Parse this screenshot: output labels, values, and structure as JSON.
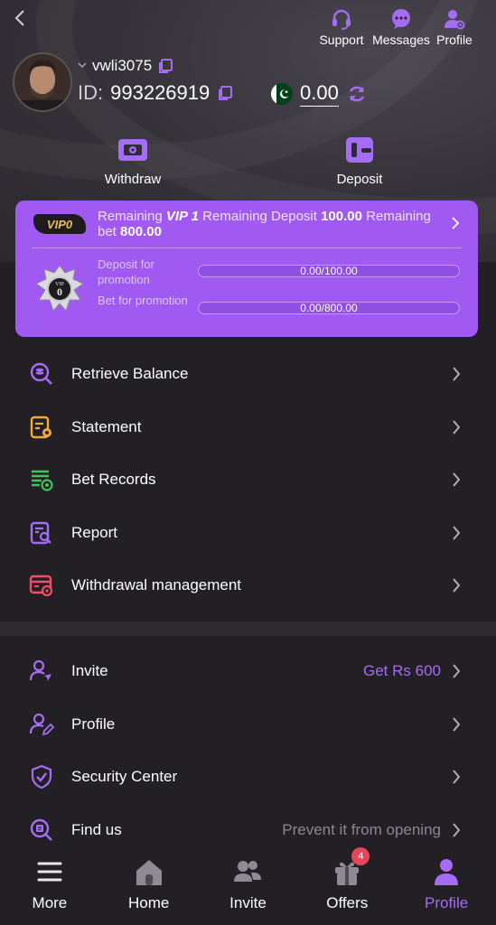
{
  "header": {
    "support_label": "Support",
    "messages_label": "Messages",
    "profile_label": "Profile",
    "username": "vwli3075",
    "id_label": "ID:",
    "id_value": "993226919",
    "balance": "0.00"
  },
  "actions": {
    "withdraw_label": "Withdraw",
    "deposit_label": "Deposit"
  },
  "vip": {
    "badge": "VIP0",
    "text_remaining": "Remaining ",
    "text_level": "VIP 1",
    "text_remaining_deposit": " Remaining Deposit ",
    "deposit_amount": "100.00",
    "text_remaining_bet": " Remaining bet ",
    "bet_amount": "800.00",
    "emblem_level": "0",
    "deposit_label": "Deposit for promotion",
    "deposit_progress": "0.00/100.00",
    "bet_label": "Bet for promotion",
    "bet_progress": "0.00/800.00"
  },
  "menu_primary": [
    {
      "label": "Retrieve Balance",
      "icon": "retrieve-balance-icon",
      "color": "#a56cf5"
    },
    {
      "label": "Statement",
      "icon": "statement-icon",
      "color": "#f0a93a"
    },
    {
      "label": "Bet Records",
      "icon": "bet-records-icon",
      "color": "#3fc45a"
    },
    {
      "label": "Report",
      "icon": "report-icon",
      "color": "#a56cf5"
    },
    {
      "label": "Withdrawal management",
      "icon": "withdrawal-management-icon",
      "color": "#ef4e6a"
    }
  ],
  "menu_secondary": [
    {
      "label": "Invite",
      "extra": "Get Rs 600",
      "extra_color": "#a56cf5"
    },
    {
      "label": "Profile",
      "extra": ""
    },
    {
      "label": "Security Center",
      "extra": ""
    },
    {
      "label": "Find us",
      "extra": "Prevent it from opening",
      "extra_color": "#8a878f"
    }
  ],
  "bottom_nav": {
    "more": "More",
    "home": "Home",
    "invite": "Invite",
    "offers": "Offers",
    "offers_badge": "4",
    "profile": "Profile"
  },
  "colors": {
    "accent": "#a56cf5",
    "vip_card": "#a05af2",
    "background": "#222024"
  }
}
